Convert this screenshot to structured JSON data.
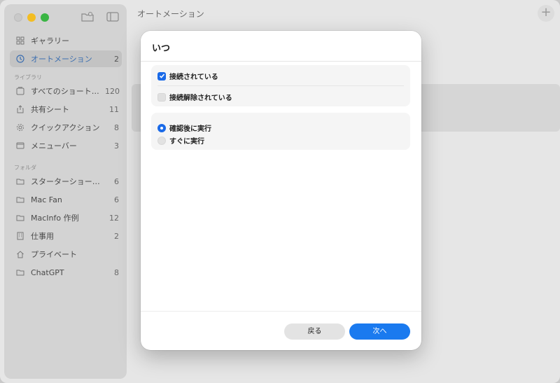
{
  "window": {
    "title": "オートメーション"
  },
  "sidebar": {
    "top": [
      {
        "label": "ギャラリー",
        "count": "",
        "icon": "gallery-icon"
      },
      {
        "label": "オートメーション",
        "count": "2",
        "icon": "clock-icon",
        "active": true
      }
    ],
    "library_heading": "ライブラリ",
    "library": [
      {
        "label": "すべてのショート…",
        "count": "120",
        "icon": "shortcuts-icon"
      },
      {
        "label": "共有シート",
        "count": "11",
        "icon": "share-icon"
      },
      {
        "label": "クイックアクション",
        "count": "8",
        "icon": "gear-icon"
      },
      {
        "label": "メニューバー",
        "count": "3",
        "icon": "menubar-icon"
      }
    ],
    "folders_heading": "フォルダ",
    "folders": [
      {
        "label": "スターターショートカ…",
        "count": "6",
        "icon": "folder-icon"
      },
      {
        "label": "Mac Fan",
        "count": "6",
        "icon": "folder-icon"
      },
      {
        "label": "MacInfo 作例",
        "count": "12",
        "icon": "folder-icon"
      },
      {
        "label": "仕事用",
        "count": "2",
        "icon": "building-icon"
      },
      {
        "label": "プライベート",
        "count": "",
        "icon": "home-icon"
      },
      {
        "label": "ChatGPT",
        "count": "8",
        "icon": "folder-icon"
      }
    ]
  },
  "main": {
    "add_label": "+"
  },
  "modal": {
    "title": "いつ",
    "checkboxes": [
      {
        "label": "接続されている",
        "checked": true
      },
      {
        "label": "接続解除されている",
        "checked": false
      }
    ],
    "radios": [
      {
        "label": "確認後に実行",
        "selected": true
      },
      {
        "label": "すぐに実行",
        "selected": false
      }
    ],
    "back_label": "戻る",
    "next_label": "次へ"
  },
  "colors": {
    "accent": "#1a7aef",
    "sidebar_active_text": "#3d6fb0"
  }
}
